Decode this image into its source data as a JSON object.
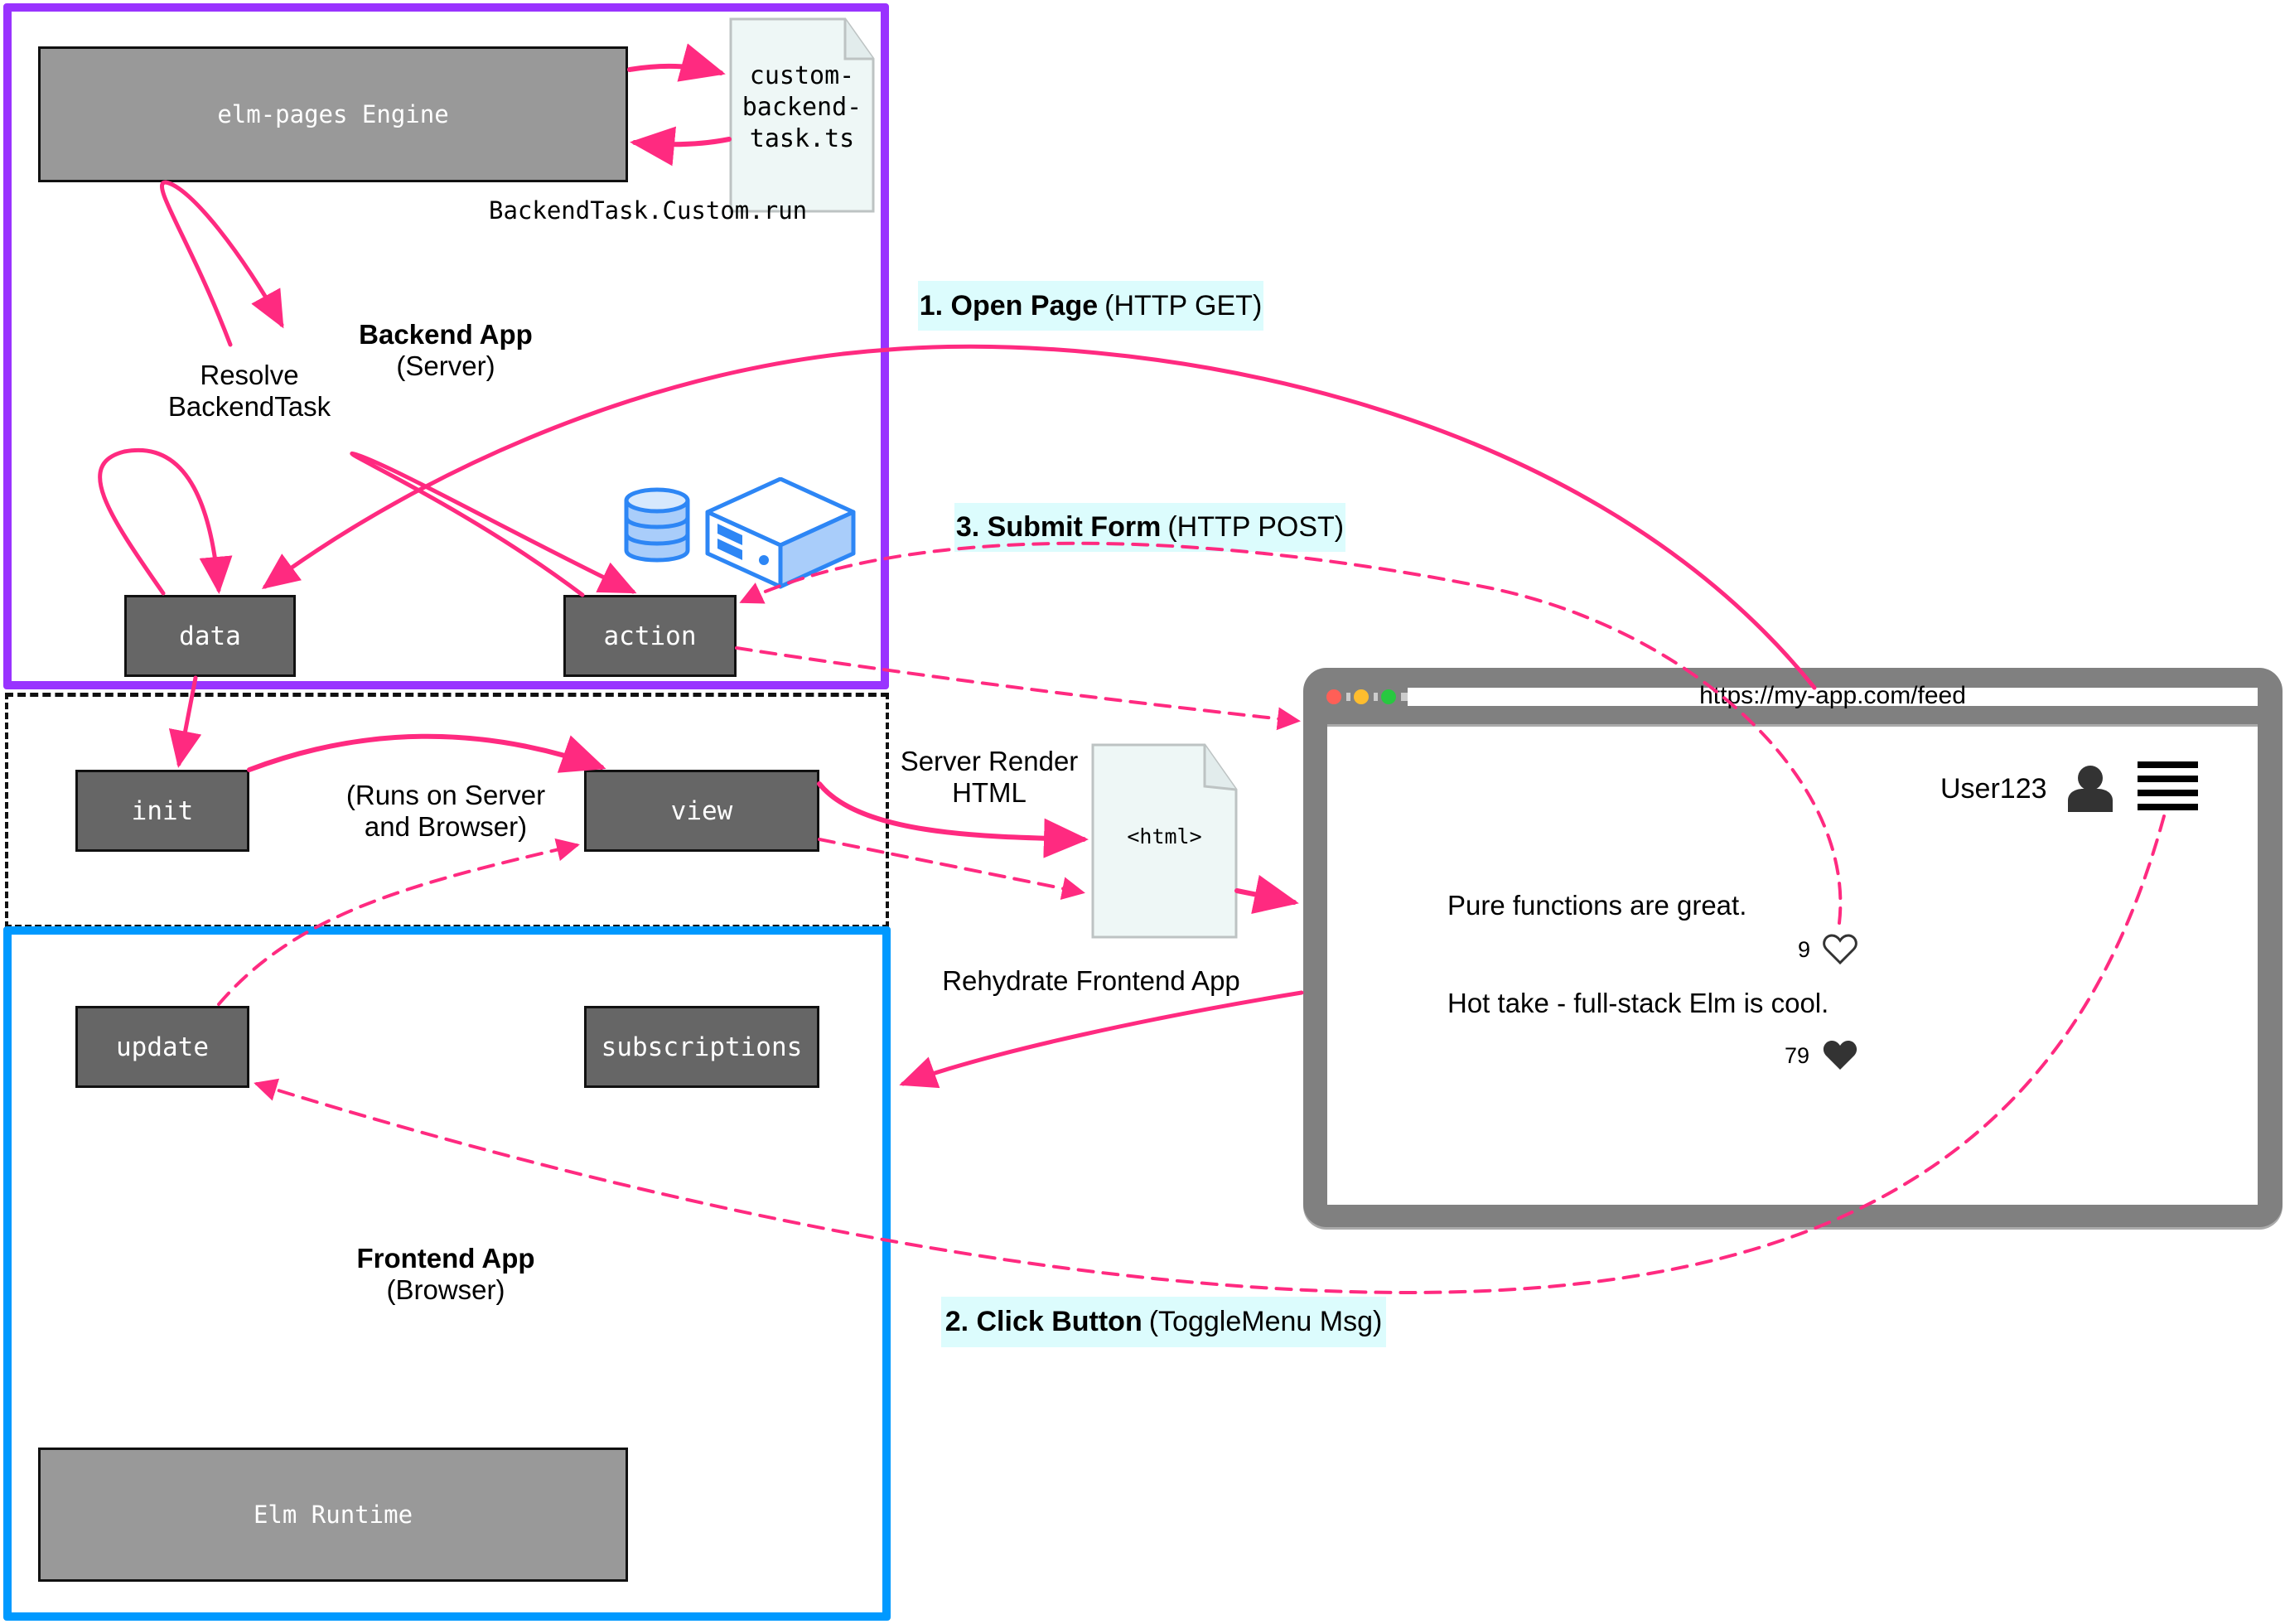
{
  "colors": {
    "backend_border": "#9933ff",
    "frontend_border": "#0099ff",
    "arrow": "#ff2a80",
    "step_label_bg": "#dcfcfd",
    "box_light": "#999999",
    "box_dark": "#666666",
    "browser_frame": "#808080"
  },
  "backend": {
    "title": "Backend App",
    "subtitle": "(Server)",
    "engine_label": "elm-pages Engine",
    "custom_file": [
      "custom-",
      "backend-",
      "task.ts"
    ],
    "custom_caption": "BackendTask.Custom.run",
    "resolve_label": [
      "Resolve",
      "BackendTask"
    ],
    "data_label": "data",
    "action_label": "action",
    "icons": [
      "database-icon",
      "server-icon"
    ]
  },
  "shared": {
    "caption": [
      "(Runs on Server",
      "and Browser)"
    ],
    "init_label": "init",
    "view_label": "view"
  },
  "frontend": {
    "title": "Frontend App",
    "subtitle": "(Browser)",
    "update_label": "update",
    "subscriptions_label": "subscriptions",
    "runtime_label": "Elm Runtime"
  },
  "render": {
    "server_render": [
      "Server Render",
      "HTML"
    ],
    "html_file": "<html>",
    "rehydrate": "Rehydrate Frontend App"
  },
  "steps": [
    {
      "number_title": "1. Open Page",
      "detail": "(HTTP GET)"
    },
    {
      "number_title": "2. Click Button",
      "detail": "(ToggleMenu Msg)"
    },
    {
      "number_title": "3. Submit Form",
      "detail": "(HTTP POST)"
    }
  ],
  "browser": {
    "url": "https://my-app.com/feed",
    "username": "User123",
    "posts": [
      {
        "text": "Pure functions are great.",
        "likes": "9",
        "liked": false
      },
      {
        "text": "Hot take - full-stack Elm is cool.",
        "likes": "79",
        "liked": true
      }
    ]
  }
}
